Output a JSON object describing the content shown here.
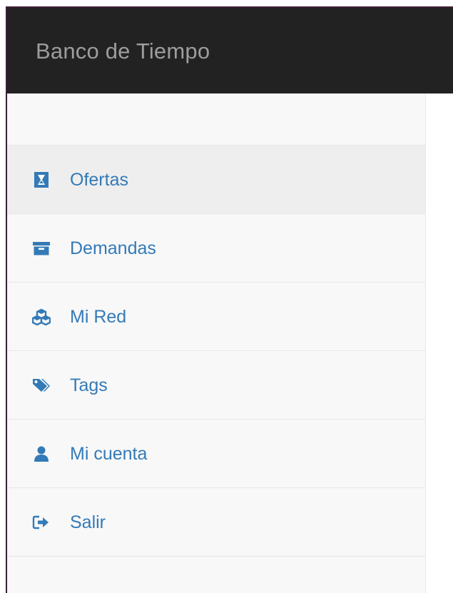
{
  "navbar": {
    "brand": "Banco de Tiempo"
  },
  "sidebar": {
    "items": [
      {
        "label": "Ofertas",
        "icon": "hourglass-icon",
        "active": true
      },
      {
        "label": "Demandas",
        "icon": "archive-box-icon",
        "active": false
      },
      {
        "label": "Mi Red",
        "icon": "cubes-icon",
        "active": false
      },
      {
        "label": "Tags",
        "icon": "tags-icon",
        "active": false
      },
      {
        "label": "Mi cuenta",
        "icon": "user-icon",
        "active": false
      },
      {
        "label": "Salir",
        "icon": "sign-out-icon",
        "active": false
      }
    ]
  },
  "colors": {
    "navbar_bg": "#222222",
    "brand_text": "#9d9d9d",
    "sidebar_bg": "#f8f8f8",
    "active_item_bg": "#eeeeee",
    "link": "#337ab7",
    "divider": "#e7e7e7"
  }
}
